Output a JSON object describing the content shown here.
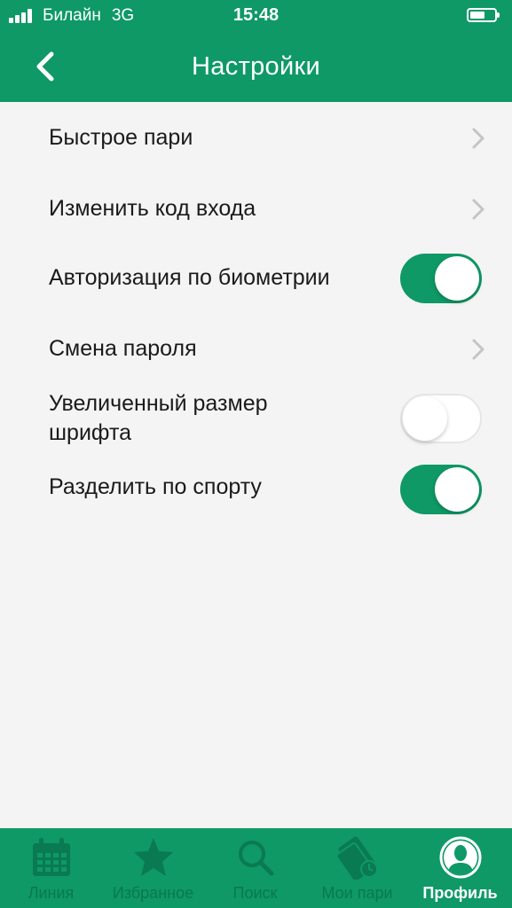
{
  "status_bar": {
    "carrier": "Билайн",
    "network": "3G",
    "time": "15:48",
    "battery_level": 0.6
  },
  "header": {
    "title": "Настройки",
    "back_icon": "chevron-left-icon"
  },
  "settings": [
    {
      "label": "Быстрое пари",
      "control": "chevron"
    },
    {
      "label": "Изменить код входа",
      "control": "chevron"
    },
    {
      "label": "Авторизация по биометрии",
      "control": "toggle",
      "on": true
    },
    {
      "label": "Смена пароля",
      "control": "chevron"
    },
    {
      "label": "Увеличенный размер шрифта",
      "control": "toggle",
      "on": false
    },
    {
      "label": "Разделить по спорту",
      "control": "toggle",
      "on": true
    }
  ],
  "tabs": [
    {
      "label": "Линия",
      "icon": "calendar-icon",
      "active": false
    },
    {
      "label": "Избранное",
      "icon": "star-icon",
      "active": false
    },
    {
      "label": "Поиск",
      "icon": "search-icon",
      "active": false
    },
    {
      "label": "Мои пари",
      "icon": "tickets-icon",
      "active": false
    },
    {
      "label": "Профиль",
      "icon": "profile-icon",
      "active": true
    }
  ],
  "colors": {
    "brand_green": "#0e9966",
    "background": "#f4f4f4",
    "inactive_tab": "#0a7a52",
    "text": "#1a1a1a"
  }
}
